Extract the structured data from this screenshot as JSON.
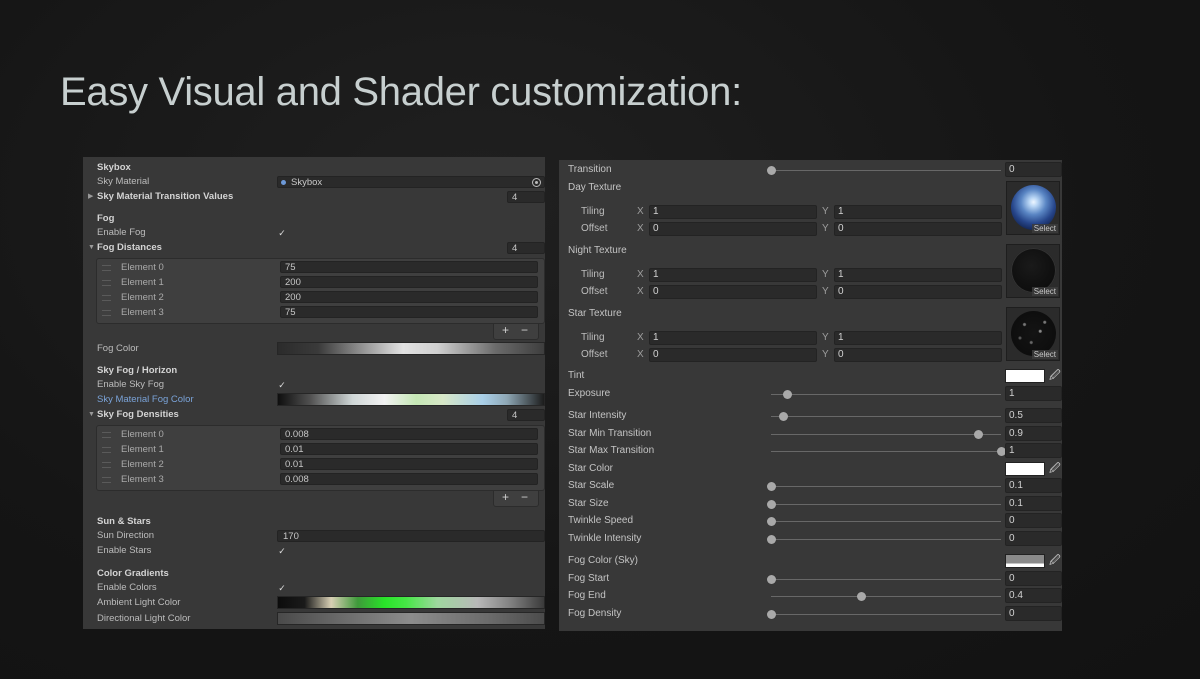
{
  "headline": "Easy Visual and Shader customization:",
  "left": {
    "skybox_header": "Skybox",
    "sky_material_label": "Sky Material",
    "sky_material_value": "Skybox",
    "sky_transition_label": "Sky Material Transition Values",
    "sky_transition_count": "4",
    "fog_header": "Fog",
    "enable_fog_label": "Enable Fog",
    "check": "✓",
    "fog_distances_label": "Fog Distances",
    "fog_distances_count": "4",
    "fog_distances": [
      {
        "label": "Element 0",
        "value": "75"
      },
      {
        "label": "Element 1",
        "value": "200"
      },
      {
        "label": "Element 2",
        "value": "200"
      },
      {
        "label": "Element 3",
        "value": "75"
      }
    ],
    "plus": "+",
    "minus": "−",
    "fog_color_label": "Fog Color",
    "sky_fog_header": "Sky Fog / Horizon",
    "enable_sky_fog_label": "Enable Sky Fog",
    "sky_material_fog_color_label": "Sky Material Fog Color",
    "sky_fog_densities_label": "Sky Fog Densities",
    "sky_fog_densities_count": "4",
    "sky_fog_densities": [
      {
        "label": "Element 0",
        "value": "0.008"
      },
      {
        "label": "Element 1",
        "value": "0.01"
      },
      {
        "label": "Element 2",
        "value": "0.01"
      },
      {
        "label": "Element 3",
        "value": "0.008"
      }
    ],
    "sun_stars_header": "Sun & Stars",
    "sun_direction_label": "Sun Direction",
    "sun_direction_value": "170",
    "enable_stars_label": "Enable Stars",
    "color_gradients_header": "Color Gradients",
    "enable_colors_label": "Enable Colors",
    "ambient_light_label": "Ambient Light Color",
    "directional_light_label": "Directional Light Color"
  },
  "right": {
    "transition": {
      "label": "Transition",
      "value": "0",
      "fraction": 0.0
    },
    "select_label": "Select",
    "tiling_label": "Tiling",
    "offset_label": "Offset",
    "x_label": "X",
    "y_label": "Y",
    "textures": [
      {
        "label": "Day Texture",
        "tiling_x": "1",
        "tiling_y": "1",
        "offset_x": "0",
        "offset_y": "0"
      },
      {
        "label": "Night Texture",
        "tiling_x": "1",
        "tiling_y": "1",
        "offset_x": "0",
        "offset_y": "0"
      },
      {
        "label": "Star Texture",
        "tiling_x": "1",
        "tiling_y": "1",
        "offset_x": "0",
        "offset_y": "0"
      }
    ],
    "tint_label": "Tint",
    "exposure": {
      "label": "Exposure",
      "value": "1",
      "fraction": 0.07
    },
    "star_intensity": {
      "label": "Star Intensity",
      "value": "0.5",
      "fraction": 0.05
    },
    "star_min_transition": {
      "label": "Star Min Transition",
      "value": "0.9",
      "fraction": 0.9
    },
    "star_max_transition": {
      "label": "Star Max Transition",
      "value": "1",
      "fraction": 1.0
    },
    "star_color_label": "Star Color",
    "star_scale": {
      "label": "Star Scale",
      "value": "0.1",
      "fraction": 0.0
    },
    "star_size": {
      "label": "Star Size",
      "value": "0.1",
      "fraction": 0.0
    },
    "twinkle_speed": {
      "label": "Twinkle Speed",
      "value": "0",
      "fraction": 0.0
    },
    "twinkle_intensity": {
      "label": "Twinkle Intensity",
      "value": "0",
      "fraction": 0.0
    },
    "fog_color_sky_label": "Fog Color (Sky)",
    "fog_start": {
      "label": "Fog Start",
      "value": "0",
      "fraction": 0.0
    },
    "fog_end": {
      "label": "Fog End",
      "value": "0.4",
      "fraction": 0.39
    },
    "fog_density": {
      "label": "Fog Density",
      "value": "0",
      "fraction": 0.0
    },
    "picker_glyph": "🖉"
  }
}
